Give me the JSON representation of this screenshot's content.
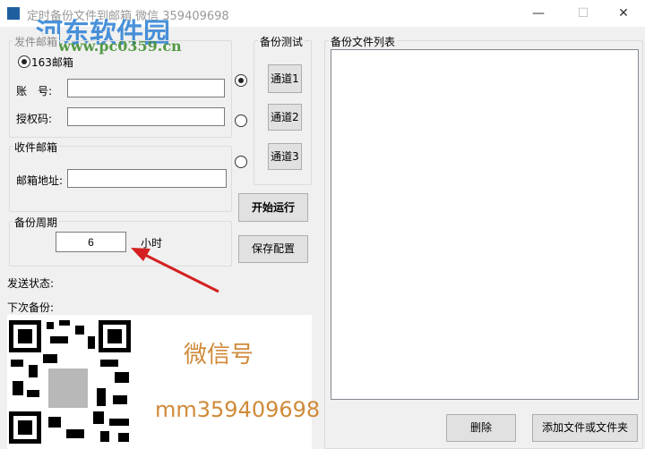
{
  "window": {
    "title": "定时备份文件到邮箱 微信 359409698",
    "minimize": "—",
    "maximize": "☐",
    "close": "✕"
  },
  "watermark": {
    "name": "河东软件园",
    "url": "www.pc0359.cn"
  },
  "sender": {
    "group": "发件邮箱",
    "radio": "163邮箱",
    "account_label": "账　号:",
    "account_value": "",
    "auth_label": "授权码:",
    "auth_value": ""
  },
  "receiver": {
    "group": "收件邮箱",
    "addr_label": "邮箱地址:",
    "addr_value": ""
  },
  "period": {
    "group": "备份周期",
    "value": "6",
    "unit": "小时"
  },
  "test": {
    "group": "备份测试",
    "channels": [
      "通道1",
      "通道2",
      "通道3"
    ],
    "selected": 0
  },
  "actions": {
    "start": "开始运行",
    "save": "保存配置"
  },
  "status": {
    "send_label": "发送状态:",
    "next_label": "下次备份:"
  },
  "promo": {
    "wechat_label": "微信号",
    "wechat_id": "mm359409698"
  },
  "filelist": {
    "group": "备份文件列表",
    "delete": "删除",
    "add": "添加文件或文件夹"
  },
  "colors": {
    "promo_text": "#d08a3a",
    "arrow": "#d42020"
  }
}
